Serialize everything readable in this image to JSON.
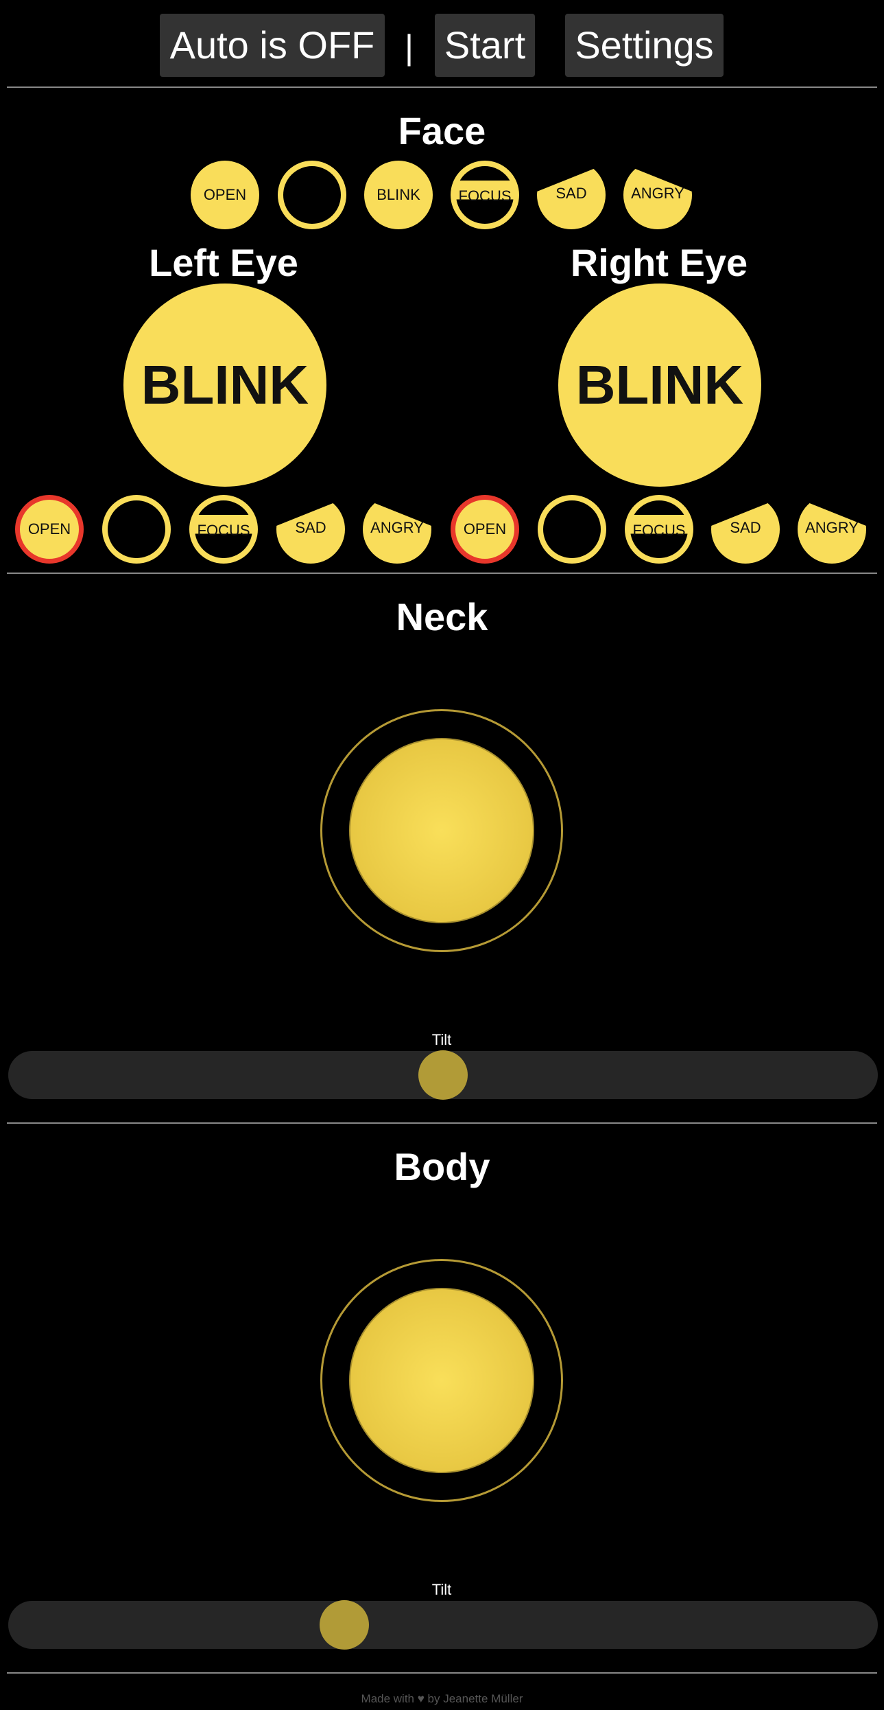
{
  "header": {
    "auto_label": "Auto is OFF",
    "separator": "|",
    "start_label": "Start",
    "settings_label": "Settings"
  },
  "face": {
    "title": "Face",
    "buttons": [
      {
        "label": "OPEN",
        "style": "filled"
      },
      {
        "label": "",
        "style": "ring"
      },
      {
        "label": "BLINK",
        "style": "filled"
      },
      {
        "label": "FOCUS",
        "style": "ring-band"
      },
      {
        "label": "SAD",
        "style": "sad"
      },
      {
        "label": "ANGRY",
        "style": "angry"
      }
    ]
  },
  "left_eye": {
    "title": "Left Eye",
    "blink_label": "BLINK",
    "buttons": [
      {
        "label": "OPEN",
        "style": "filled",
        "selected": true
      },
      {
        "label": "",
        "style": "ring"
      },
      {
        "label": "FOCUS",
        "style": "ring-band"
      },
      {
        "label": "SAD",
        "style": "sad"
      },
      {
        "label": "ANGRY",
        "style": "angry"
      }
    ]
  },
  "right_eye": {
    "title": "Right Eye",
    "blink_label": "BLINK",
    "buttons": [
      {
        "label": "OPEN",
        "style": "filled",
        "selected": true
      },
      {
        "label": "",
        "style": "ring"
      },
      {
        "label": "FOCUS",
        "style": "ring-band"
      },
      {
        "label": "SAD",
        "style": "sad"
      },
      {
        "label": "ANGRY",
        "style": "angry"
      }
    ]
  },
  "neck": {
    "title": "Neck",
    "tilt_label": "Tilt",
    "tilt_value": 0.5
  },
  "body": {
    "title": "Body",
    "tilt_label": "Tilt",
    "tilt_value": 0.38
  },
  "footer": {
    "text": "Made with ♥ by Jeanette Müller"
  },
  "colors": {
    "accent": "#f9dd5a",
    "selected_ring": "#e8372b",
    "button_bg": "#333333"
  }
}
